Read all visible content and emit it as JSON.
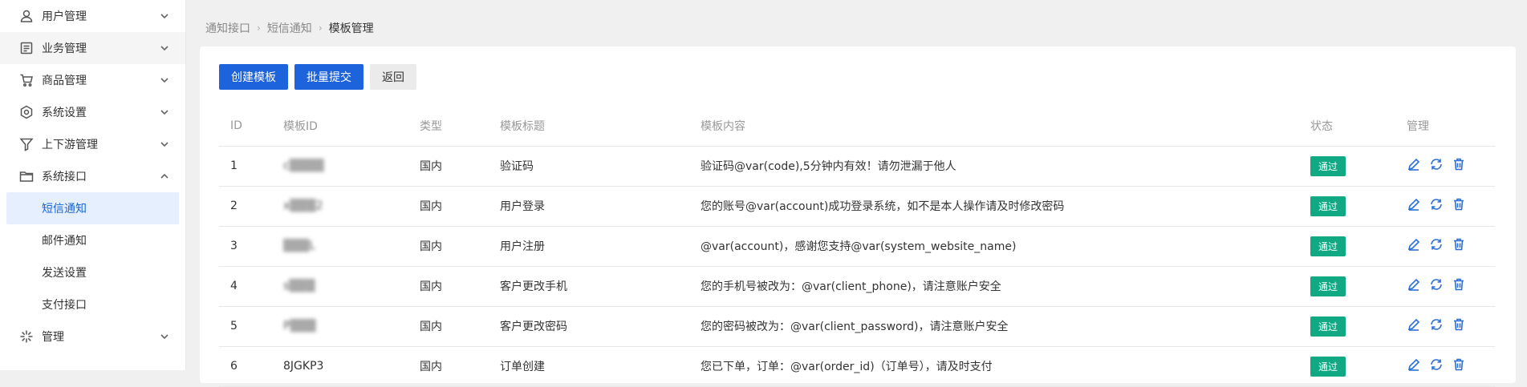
{
  "sidebar": {
    "items": [
      {
        "label": "用户管理",
        "icon": "user-icon"
      },
      {
        "label": "业务管理",
        "icon": "list-icon"
      },
      {
        "label": "商品管理",
        "icon": "cart-icon"
      },
      {
        "label": "系统设置",
        "icon": "hexagon-settings-icon"
      },
      {
        "label": "上下游管理",
        "icon": "filter-icon"
      },
      {
        "label": "系统接口",
        "icon": "folder-icon"
      }
    ],
    "sub_items": [
      {
        "label": "短信通知",
        "active": true
      },
      {
        "label": "邮件通知"
      },
      {
        "label": "发送设置"
      },
      {
        "label": "支付接口"
      }
    ],
    "last_item": {
      "label": "管理",
      "icon": "sparkle-icon"
    }
  },
  "breadcrumb": [
    "通知接口",
    "短信通知",
    "模板管理"
  ],
  "toolbar": {
    "create": "创建模板",
    "batch_submit": "批量提交",
    "back": "返回"
  },
  "table": {
    "headers": [
      "ID",
      "模板ID",
      "类型",
      "模板标题",
      "模板内容",
      "状态",
      "管理"
    ],
    "rows": [
      {
        "id": "1",
        "tid": "c▒▒▒▒",
        "type": "国内",
        "title": "验证码",
        "content": "验证码@var(code),5分钟内有效！请勿泄漏于他人",
        "status": "通过"
      },
      {
        "id": "2",
        "tid": "x▒▒▒2",
        "type": "国内",
        "title": "用户登录",
        "content": "您的账号@var(account)成功登录系统，如不是本人操作请及时修改密码",
        "status": "通过"
      },
      {
        "id": "3",
        "tid": "▒▒▒L",
        "type": "国内",
        "title": "用户注册",
        "content": "@var(account)，感谢您支持@var(system_website_name)",
        "status": "通过"
      },
      {
        "id": "4",
        "tid": "s▒▒▒",
        "type": "国内",
        "title": "客户更改手机",
        "content": "您的手机号被改为：@var(client_phone)，请注意账户安全",
        "status": "通过"
      },
      {
        "id": "5",
        "tid": "P▒▒▒",
        "type": "国内",
        "title": "客户更改密码",
        "content": "您的密码被改为：@var(client_password)，请注意账户安全",
        "status": "通过"
      },
      {
        "id": "6",
        "tid": "8JGKP3",
        "type": "国内",
        "title": "订单创建",
        "content": "您已下单，订单：@var(order_id)（订单号），请及时支付",
        "status": "通过"
      }
    ]
  },
  "colors": {
    "primary": "#1d63dc",
    "status_pass": "#11a983",
    "active_bg": "#e6effd"
  }
}
